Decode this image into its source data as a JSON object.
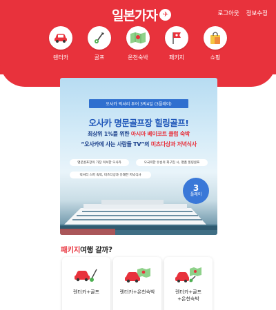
{
  "header": {
    "logo_text": "일본가자",
    "logo_badge": "✈",
    "links": {
      "logout": "로그아웃",
      "profile": "정보수정"
    },
    "bg_color": "#e8323c"
  },
  "categories": [
    {
      "label": "렌터카",
      "icon": "car-icon"
    },
    {
      "label": "골프",
      "icon": "golf-icon"
    },
    {
      "label": "온천숙박",
      "icon": "onsen-map-icon"
    },
    {
      "label": "패키지",
      "icon": "flag-icon"
    },
    {
      "label": "쇼핑",
      "icon": "shopping-bag-icon"
    }
  ],
  "banner": {
    "tag": "오사카 럭셔리 투어 3박4일 (3플레이)",
    "title": "오사카 명문골프장 힐링골프!",
    "line1_a": "최상위 1%를 위한 ",
    "line1_b": "아시아 베이코트 클럽 숙박",
    "line2_a": "“오사카에 사는 사람들 TV”의 ",
    "line2_b": "미츠다상과 저녁식사",
    "pills": [
      "명문골프장의 가장 럭셔한 오사카",
      "오국럭한 유송의 회구입 시, 명품 힐링골프",
      "럭셔리 스파 숙박, 미츠다상과 유쾌한 저녁식사"
    ],
    "play_num": "3",
    "play_txt": "플레이"
  },
  "section": {
    "title_red": "패키지",
    "title_rest": "여행 갈까?"
  },
  "packages": [
    {
      "label": "렌터카+골프",
      "icon": "car-golf-icon"
    },
    {
      "label": "렌터카+온천숙박",
      "icon": "car-onsen-icon"
    },
    {
      "label": "렌터카+골프\n+온천숙박",
      "icon": "car-golf-onsen-icon"
    }
  ]
}
